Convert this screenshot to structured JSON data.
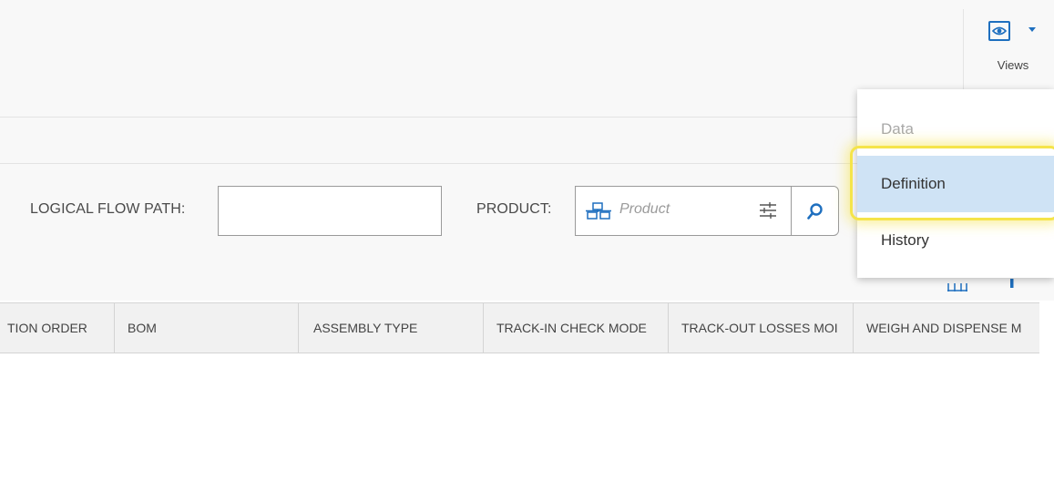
{
  "toolbar": {
    "views_label": "Views"
  },
  "filters": {
    "logical_flow_path_label": "LOGICAL FLOW PATH:",
    "logical_flow_path_value": "",
    "product_label": "PRODUCT:",
    "product_placeholder": "Product"
  },
  "grid": {
    "columns": [
      "TION ORDER",
      "BOM",
      "ASSEMBLY TYPE",
      "TRACK-IN CHECK MODE",
      "TRACK-OUT LOSSES MOI",
      "WEIGH AND DISPENSE M"
    ]
  },
  "views_menu": {
    "items": [
      {
        "label": "Data",
        "state": "disabled"
      },
      {
        "label": "Definition",
        "state": "selected"
      },
      {
        "label": "History",
        "state": "normal"
      }
    ]
  },
  "colors": {
    "accent": "#1e6fbf",
    "selected_bg": "#cfe3f5",
    "highlight": "#f5e44a"
  }
}
